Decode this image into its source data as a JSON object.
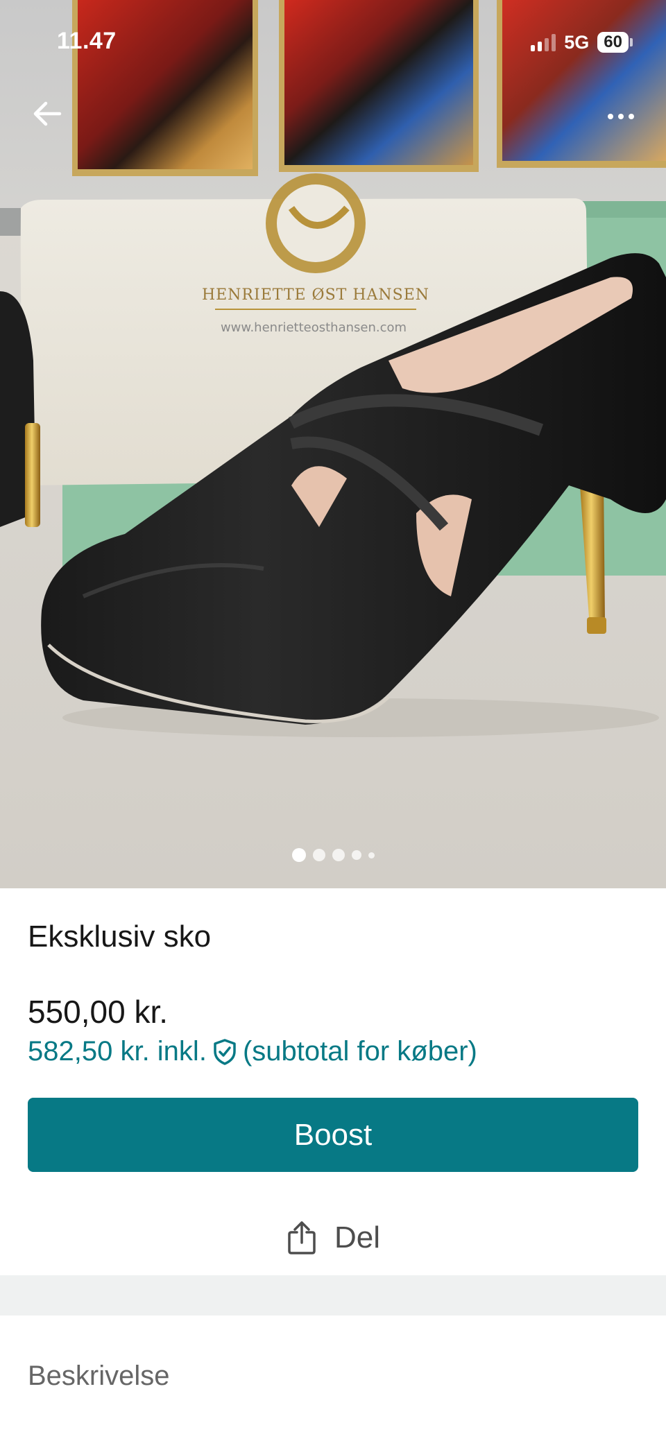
{
  "status_bar": {
    "time": "11.47",
    "network": "5G",
    "battery": "60"
  },
  "photo": {
    "bag_brand": "HENRIETTE ØST HANSEN",
    "bag_url": "www.henrietteosthansen.com",
    "pager": {
      "count": 5,
      "active_index": 0
    }
  },
  "listing": {
    "title": "Eksklusiv sko",
    "price": "550,00 kr.",
    "price_incl": "582,50 kr. inkl.",
    "price_incl_note": "(subtotal for køber)"
  },
  "actions": {
    "boost_label": "Boost",
    "share_label": "Del"
  },
  "sections": {
    "description_label": "Beskrivelse"
  },
  "colors": {
    "accent": "#077985",
    "divider": "#eff1f1"
  },
  "icons": {
    "back": "arrow-left-icon",
    "more": "more-dots-icon",
    "buyer_protection": "shield-check-icon",
    "share": "share-icon"
  }
}
